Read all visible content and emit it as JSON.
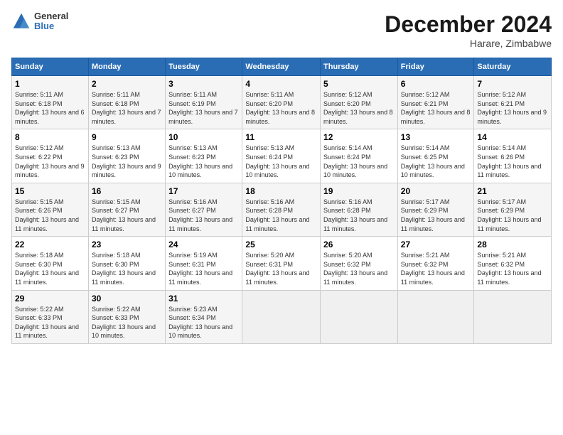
{
  "header": {
    "logo_line1": "General",
    "logo_line2": "Blue",
    "month": "December 2024",
    "location": "Harare, Zimbabwe"
  },
  "weekdays": [
    "Sunday",
    "Monday",
    "Tuesday",
    "Wednesday",
    "Thursday",
    "Friday",
    "Saturday"
  ],
  "weeks": [
    [
      {
        "day": "1",
        "sunrise": "5:11 AM",
        "sunset": "6:18 PM",
        "daylight": "13 hours and 6 minutes."
      },
      {
        "day": "2",
        "sunrise": "5:11 AM",
        "sunset": "6:18 PM",
        "daylight": "13 hours and 7 minutes."
      },
      {
        "day": "3",
        "sunrise": "5:11 AM",
        "sunset": "6:19 PM",
        "daylight": "13 hours and 7 minutes."
      },
      {
        "day": "4",
        "sunrise": "5:11 AM",
        "sunset": "6:20 PM",
        "daylight": "13 hours and 8 minutes."
      },
      {
        "day": "5",
        "sunrise": "5:12 AM",
        "sunset": "6:20 PM",
        "daylight": "13 hours and 8 minutes."
      },
      {
        "day": "6",
        "sunrise": "5:12 AM",
        "sunset": "6:21 PM",
        "daylight": "13 hours and 8 minutes."
      },
      {
        "day": "7",
        "sunrise": "5:12 AM",
        "sunset": "6:21 PM",
        "daylight": "13 hours and 9 minutes."
      }
    ],
    [
      {
        "day": "8",
        "sunrise": "5:12 AM",
        "sunset": "6:22 PM",
        "daylight": "13 hours and 9 minutes."
      },
      {
        "day": "9",
        "sunrise": "5:13 AM",
        "sunset": "6:23 PM",
        "daylight": "13 hours and 9 minutes."
      },
      {
        "day": "10",
        "sunrise": "5:13 AM",
        "sunset": "6:23 PM",
        "daylight": "13 hours and 10 minutes."
      },
      {
        "day": "11",
        "sunrise": "5:13 AM",
        "sunset": "6:24 PM",
        "daylight": "13 hours and 10 minutes."
      },
      {
        "day": "12",
        "sunrise": "5:14 AM",
        "sunset": "6:24 PM",
        "daylight": "13 hours and 10 minutes."
      },
      {
        "day": "13",
        "sunrise": "5:14 AM",
        "sunset": "6:25 PM",
        "daylight": "13 hours and 10 minutes."
      },
      {
        "day": "14",
        "sunrise": "5:14 AM",
        "sunset": "6:26 PM",
        "daylight": "13 hours and 11 minutes."
      }
    ],
    [
      {
        "day": "15",
        "sunrise": "5:15 AM",
        "sunset": "6:26 PM",
        "daylight": "13 hours and 11 minutes."
      },
      {
        "day": "16",
        "sunrise": "5:15 AM",
        "sunset": "6:27 PM",
        "daylight": "13 hours and 11 minutes."
      },
      {
        "day": "17",
        "sunrise": "5:16 AM",
        "sunset": "6:27 PM",
        "daylight": "13 hours and 11 minutes."
      },
      {
        "day": "18",
        "sunrise": "5:16 AM",
        "sunset": "6:28 PM",
        "daylight": "13 hours and 11 minutes."
      },
      {
        "day": "19",
        "sunrise": "5:16 AM",
        "sunset": "6:28 PM",
        "daylight": "13 hours and 11 minutes."
      },
      {
        "day": "20",
        "sunrise": "5:17 AM",
        "sunset": "6:29 PM",
        "daylight": "13 hours and 11 minutes."
      },
      {
        "day": "21",
        "sunrise": "5:17 AM",
        "sunset": "6:29 PM",
        "daylight": "13 hours and 11 minutes."
      }
    ],
    [
      {
        "day": "22",
        "sunrise": "5:18 AM",
        "sunset": "6:30 PM",
        "daylight": "13 hours and 11 minutes."
      },
      {
        "day": "23",
        "sunrise": "5:18 AM",
        "sunset": "6:30 PM",
        "daylight": "13 hours and 11 minutes."
      },
      {
        "day": "24",
        "sunrise": "5:19 AM",
        "sunset": "6:31 PM",
        "daylight": "13 hours and 11 minutes."
      },
      {
        "day": "25",
        "sunrise": "5:20 AM",
        "sunset": "6:31 PM",
        "daylight": "13 hours and 11 minutes."
      },
      {
        "day": "26",
        "sunrise": "5:20 AM",
        "sunset": "6:32 PM",
        "daylight": "13 hours and 11 minutes."
      },
      {
        "day": "27",
        "sunrise": "5:21 AM",
        "sunset": "6:32 PM",
        "daylight": "13 hours and 11 minutes."
      },
      {
        "day": "28",
        "sunrise": "5:21 AM",
        "sunset": "6:32 PM",
        "daylight": "13 hours and 11 minutes."
      }
    ],
    [
      {
        "day": "29",
        "sunrise": "5:22 AM",
        "sunset": "6:33 PM",
        "daylight": "13 hours and 11 minutes."
      },
      {
        "day": "30",
        "sunrise": "5:22 AM",
        "sunset": "6:33 PM",
        "daylight": "13 hours and 10 minutes."
      },
      {
        "day": "31",
        "sunrise": "5:23 AM",
        "sunset": "6:34 PM",
        "daylight": "13 hours and 10 minutes."
      },
      null,
      null,
      null,
      null
    ]
  ]
}
